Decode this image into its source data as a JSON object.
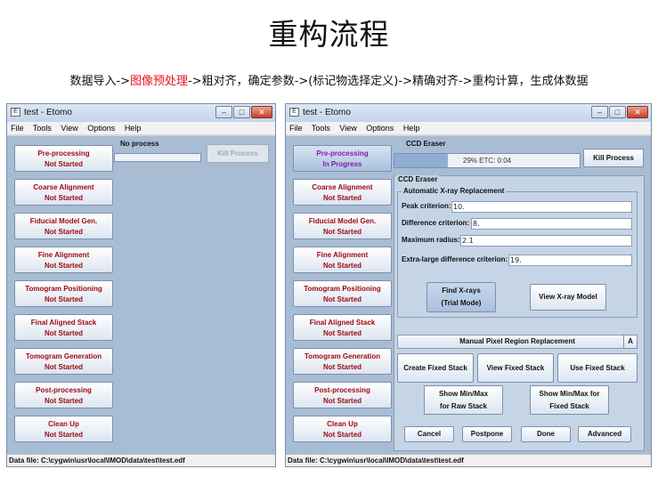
{
  "slide": {
    "title": "重构流程",
    "subtitle_pre": "数据导入->",
    "subtitle_highlight": "图像预处理",
    "subtitle_post": "->粗对齐，确定参数->(标记物选择定义)->精确对齐->重构计算，生成体数据",
    "highlight_color": "#e8141b"
  },
  "windows": [
    {
      "title": "test - Etomo",
      "menu": [
        "File",
        "Tools",
        "View",
        "Options",
        "Help"
      ],
      "header": "No process",
      "kill_label": "Kill Process",
      "steps": [
        {
          "label": "Pre-processing",
          "status": "Not Started"
        },
        {
          "label": "Coarse Alignment",
          "status": "Not Started"
        },
        {
          "label": "Fiducial Model Gen.",
          "status": "Not Started"
        },
        {
          "label": "Fine Alignment",
          "status": "Not Started"
        },
        {
          "label": "Tomogram Positioning",
          "status": "Not Started"
        },
        {
          "label": "Final Aligned Stack",
          "status": "Not Started"
        },
        {
          "label": "Tomogram Generation",
          "status": "Not Started"
        },
        {
          "label": "Post-processing",
          "status": "Not Started"
        },
        {
          "label": "Clean Up",
          "status": "Not Started"
        }
      ],
      "status_bar": "Data file: C:\\cygwin\\usr\\local\\IMOD\\data\\test\\test.edf"
    },
    {
      "title": "test - Etomo",
      "menu": [
        "File",
        "Tools",
        "View",
        "Options",
        "Help"
      ],
      "header": "CCD Eraser",
      "progress": {
        "fraction": 0.29,
        "text": "29%  ETC: 0:04"
      },
      "kill_label": "Kill Process",
      "steps": [
        {
          "label": "Pre-processing",
          "status": "In Progress"
        },
        {
          "label": "Coarse Alignment",
          "status": "Not Started"
        },
        {
          "label": "Fiducial Model Gen.",
          "status": "Not Started"
        },
        {
          "label": "Fine Alignment",
          "status": "Not Started"
        },
        {
          "label": "Tomogram Positioning",
          "status": "Not Started"
        },
        {
          "label": "Final Aligned Stack",
          "status": "Not Started"
        },
        {
          "label": "Tomogram Generation",
          "status": "Not Started"
        },
        {
          "label": "Post-processing",
          "status": "Not Started"
        },
        {
          "label": "Clean Up",
          "status": "Not Started"
        }
      ],
      "panel": {
        "title": "CCD Eraser",
        "auto_title": "Automatic X-ray Replacement",
        "fields": [
          {
            "label": "Peak criterion:",
            "value": "10."
          },
          {
            "label": "Difference criterion:",
            "value": "8."
          },
          {
            "label": "Maximum radius:",
            "value": "2.1"
          },
          {
            "label": "Extra-large difference criterion:",
            "value": "19."
          }
        ],
        "find_xrays": "Find X-rays (Trial Mode)",
        "view_xray_model": "View X-ray Model",
        "manual_title": "Manual Pixel Region Replacement",
        "manual_toggle": "A",
        "create_fixed": "Create Fixed Stack",
        "view_fixed": "View Fixed Stack",
        "use_fixed": "Use Fixed Stack",
        "minmax_raw": "Show Min/Max for Raw Stack",
        "minmax_fixed": "Show Min/Max for Fixed Stack",
        "cancel": "Cancel",
        "postpone": "Postpone",
        "done": "Done",
        "advanced": "Advanced"
      },
      "status_bar": "Data file: C:\\cygwin\\usr\\local\\IMOD\\data\\test\\test.edf"
    }
  ],
  "icons": [
    "app-icon",
    "minimize-icon",
    "maximize-icon",
    "close-icon"
  ]
}
